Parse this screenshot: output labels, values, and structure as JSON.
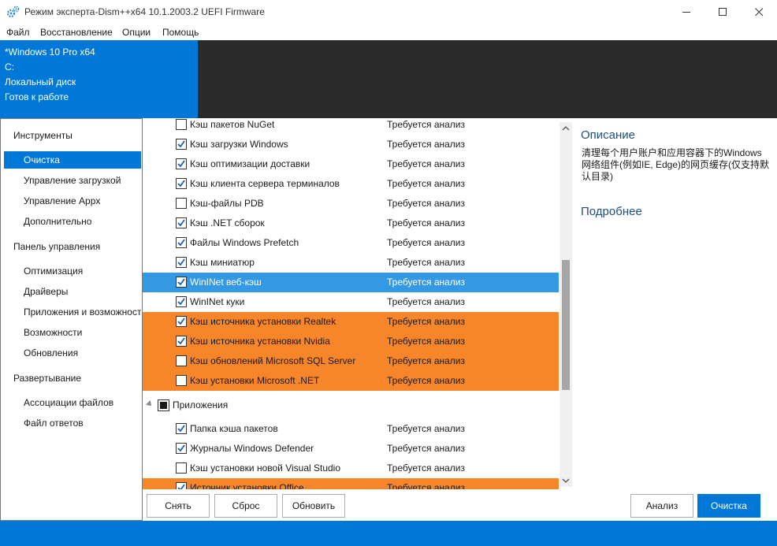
{
  "window": {
    "title": "Режим эксперта-Dism++x64 10.1.2003.2 UEFI Firmware"
  },
  "menu": [
    "Файл",
    "Восстановление",
    "Опции",
    "Помощь"
  ],
  "info": {
    "os": "*Windows 10 Pro x64",
    "drive": "C:",
    "disk_type": "Локальный диск",
    "state": "Готов к работе"
  },
  "nav": {
    "groups": [
      {
        "label": "Инструменты",
        "items": [
          "Очистка",
          "Управление загрузкой",
          "Управление Appx",
          "Дополнительно"
        ]
      },
      {
        "label": "Панель управления",
        "items": [
          "Оптимизация",
          "Драйверы",
          "Приложения и возможности",
          "Возможности",
          "Обновления"
        ]
      },
      {
        "label": "Развертывание",
        "items": [
          "Ассоциации файлов",
          "Файл ответов"
        ]
      }
    ],
    "active": "Очистка"
  },
  "list": {
    "rows": [
      {
        "name": "Кэш пакетов NuGet",
        "status": "Требуется анализ",
        "checked": false,
        "style": "normal"
      },
      {
        "name": "Кэш загрузки Windows",
        "status": "Требуется анализ",
        "checked": true,
        "style": "normal"
      },
      {
        "name": "Кэш оптимизации доставки",
        "status": "Требуется анализ",
        "checked": true,
        "style": "normal"
      },
      {
        "name": "Кэш клиента сервера терминалов",
        "status": "Требуется анализ",
        "checked": true,
        "style": "normal"
      },
      {
        "name": "Кэш-файлы PDB",
        "status": "Требуется анализ",
        "checked": false,
        "style": "normal"
      },
      {
        "name": "Кэш .NET сборок",
        "status": "Требуется анализ",
        "checked": true,
        "style": "normal"
      },
      {
        "name": "Файлы Windows Prefetch",
        "status": "Требуется анализ",
        "checked": true,
        "style": "normal"
      },
      {
        "name": "Кэш миниатюр",
        "status": "Требуется анализ",
        "checked": true,
        "style": "normal"
      },
      {
        "name": "WinINet веб-кэш",
        "status": "Требуется анализ",
        "checked": true,
        "style": "sel"
      },
      {
        "name": "WinINet куки",
        "status": "Требуется анализ",
        "checked": true,
        "style": "normal"
      },
      {
        "name": "Кэш источника установки Realtek",
        "status": "Требуется анализ",
        "checked": true,
        "style": "warn"
      },
      {
        "name": "Кэш источника установки Nvidia",
        "status": "Требуется анализ",
        "checked": true,
        "style": "warn"
      },
      {
        "name": "Кэш обновлений Microsoft SQL Server",
        "status": "Требуется анализ",
        "checked": false,
        "style": "warn"
      },
      {
        "name": "Кэш установки Microsoft .NET",
        "status": "Требуется анализ",
        "checked": false,
        "style": "warn"
      }
    ],
    "group": {
      "name": "Приложения"
    },
    "rows2": [
      {
        "name": "Папка кэша пакетов",
        "status": "Требуется анализ",
        "checked": true,
        "style": "normal"
      },
      {
        "name": "Журналы Windows Defender",
        "status": "Требуется анализ",
        "checked": true,
        "style": "normal"
      },
      {
        "name": "Кэш установки новой Visual Studio",
        "status": "Требуется анализ",
        "checked": false,
        "style": "normal"
      },
      {
        "name": "Источник установки Office",
        "status": "Требуется анализ",
        "checked": true,
        "style": "warn"
      }
    ]
  },
  "description": {
    "title": "Описание",
    "text": "清理每个用户账户和应用容器下的Windows网络组件(例如IE, Edge)的网页缓存(仅支持默认目录)",
    "more": "Подробнее"
  },
  "buttons": {
    "remove": "Снять",
    "reset": "Сброс",
    "refresh": "Обновить",
    "analyze": "Анализ",
    "clean": "Очистка"
  },
  "colors": {
    "accent": "#0078d7",
    "selected_row": "#3399e5",
    "warning_row": "#f7852a",
    "dark_panel": "#2b2b2b"
  }
}
